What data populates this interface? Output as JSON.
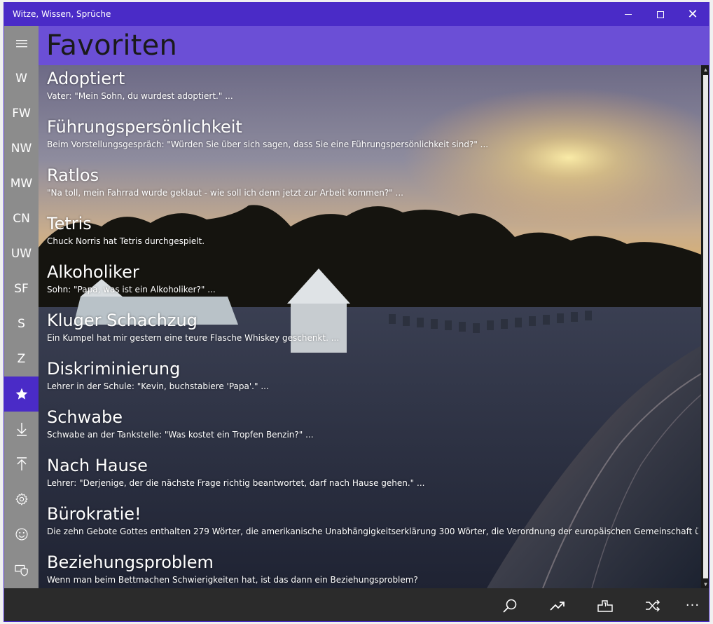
{
  "window": {
    "title": "Witze, Wissen, Sprüche",
    "accent": "#4a2bc7",
    "header_color": "#6b4fd6"
  },
  "sidebar": {
    "items": [
      {
        "label": "",
        "icon": "hamburger-icon"
      },
      {
        "label": "W"
      },
      {
        "label": "FW"
      },
      {
        "label": "NW"
      },
      {
        "label": "MW"
      },
      {
        "label": "CN"
      },
      {
        "label": "UW"
      },
      {
        "label": "SF"
      },
      {
        "label": "S"
      },
      {
        "label": "Z"
      },
      {
        "label": "",
        "icon": "star-icon",
        "active": true
      },
      {
        "label": "",
        "icon": "download-icon"
      },
      {
        "label": "",
        "icon": "upload-icon"
      },
      {
        "label": "",
        "icon": "gear-icon"
      },
      {
        "label": "",
        "icon": "smiley-icon"
      },
      {
        "label": "",
        "icon": "shield-icon"
      }
    ]
  },
  "page": {
    "title": "Favoriten"
  },
  "favorites": [
    {
      "title": "Adoptiert",
      "text": "Vater: \"Mein Sohn, du wurdest adoptiert.\" ..."
    },
    {
      "title": "Führungspersönlichkeit",
      "text": "Beim Vorstellungsgespräch: \"Würden Sie über sich sagen, dass Sie eine Führungspersönlichkeit sind?\" ..."
    },
    {
      "title": "Ratlos",
      "text": "\"Na toll, mein Fahrrad wurde geklaut - wie soll ich denn jetzt zur Arbeit kommen?\" ..."
    },
    {
      "title": "Tetris",
      "text": "Chuck Norris hat Tetris durchgespielt."
    },
    {
      "title": "Alkoholiker",
      "text": "Sohn: \"Papa, was ist ein Alkoholiker?\" ..."
    },
    {
      "title": "Kluger Schachzug",
      "text": "Ein Kumpel hat mir gestern eine teure Flasche Whiskey geschenkt. ..."
    },
    {
      "title": "Diskriminierung",
      "text": "Lehrer in der Schule: \"Kevin, buchstabiere 'Papa'.\" ..."
    },
    {
      "title": "Schwabe",
      "text": "Schwabe an der Tankstelle: \"Was kostet ein Tropfen Benzin?\" ..."
    },
    {
      "title": "Nach Hause",
      "text": "Lehrer: \"Derjenige, der die nächste Frage richtig beantwortet, darf nach Hause gehen.\" ..."
    },
    {
      "title": "Bürokratie!",
      "text": "Die zehn Gebote Gottes enthalten 279 Wörter, die amerikanische Unabhängigkeitserklärung 300 Wörter, die Verordnung der europäischen Gemeinschaft über den"
    },
    {
      "title": "Beziehungsproblem",
      "text": "Wenn man beim Bettmachen Schwierigkeiten hat, ist das dann ein Beziehungsproblem?"
    }
  ],
  "appbar": {
    "buttons": [
      "search-icon",
      "trending-icon",
      "ranking-icon",
      "shuffle-icon",
      "more-icon"
    ],
    "more_label": "···"
  }
}
